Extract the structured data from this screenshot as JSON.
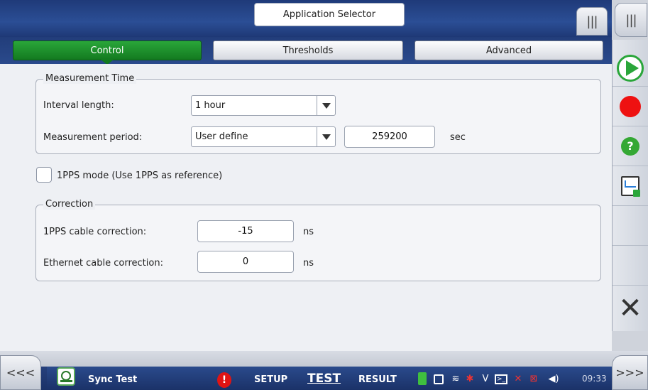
{
  "topbar": {
    "app_selector_label": "Application Selector",
    "grip_left_icon": "grip-icon",
    "grip_right_icon": "grip-icon",
    "grip_glyph": "|||"
  },
  "tabs": [
    {
      "label": "Control",
      "active": true
    },
    {
      "label": "Thresholds",
      "active": false
    },
    {
      "label": "Advanced",
      "active": false
    }
  ],
  "measurement_time": {
    "legend": "Measurement Time",
    "interval_label": "Interval length:",
    "interval_value": "1 hour",
    "period_label": "Measurement period:",
    "period_value": "User define",
    "period_seconds": "259200",
    "period_unit": "sec"
  },
  "pps_mode": {
    "checked": false,
    "label": "1PPS mode (Use 1PPS as reference)"
  },
  "correction": {
    "legend": "Correction",
    "pps_label": "1PPS cable correction:",
    "pps_value": "-15",
    "pps_unit": "ns",
    "eth_label": "Ethernet cable correction:",
    "eth_value": "0",
    "eth_unit": "ns"
  },
  "sidebar": {
    "icons": [
      "play-icon",
      "record-icon",
      "help-icon",
      "report-icon",
      "close-icon"
    ],
    "help_glyph": "?",
    "close_glyph": "✕"
  },
  "statusbar": {
    "left_chevron": "<<<",
    "right_chevron": ">>>",
    "app_name": "Sync Test",
    "alert_glyph": "!",
    "setup_label": "SETUP",
    "test_label": "TEST",
    "result_label": "RESULT",
    "time": "09:33",
    "tray_icons": [
      "power-icon",
      "storage-icon",
      "wifi-icon",
      "bluetooth-icon",
      "vlan-icon",
      "terminal-icon",
      "satellite-icon",
      "network-icon",
      "volume-icon"
    ]
  },
  "colors": {
    "accent_green": "#1e8f2c",
    "header_blue": "#24427f",
    "record_red": "#ee1111"
  }
}
